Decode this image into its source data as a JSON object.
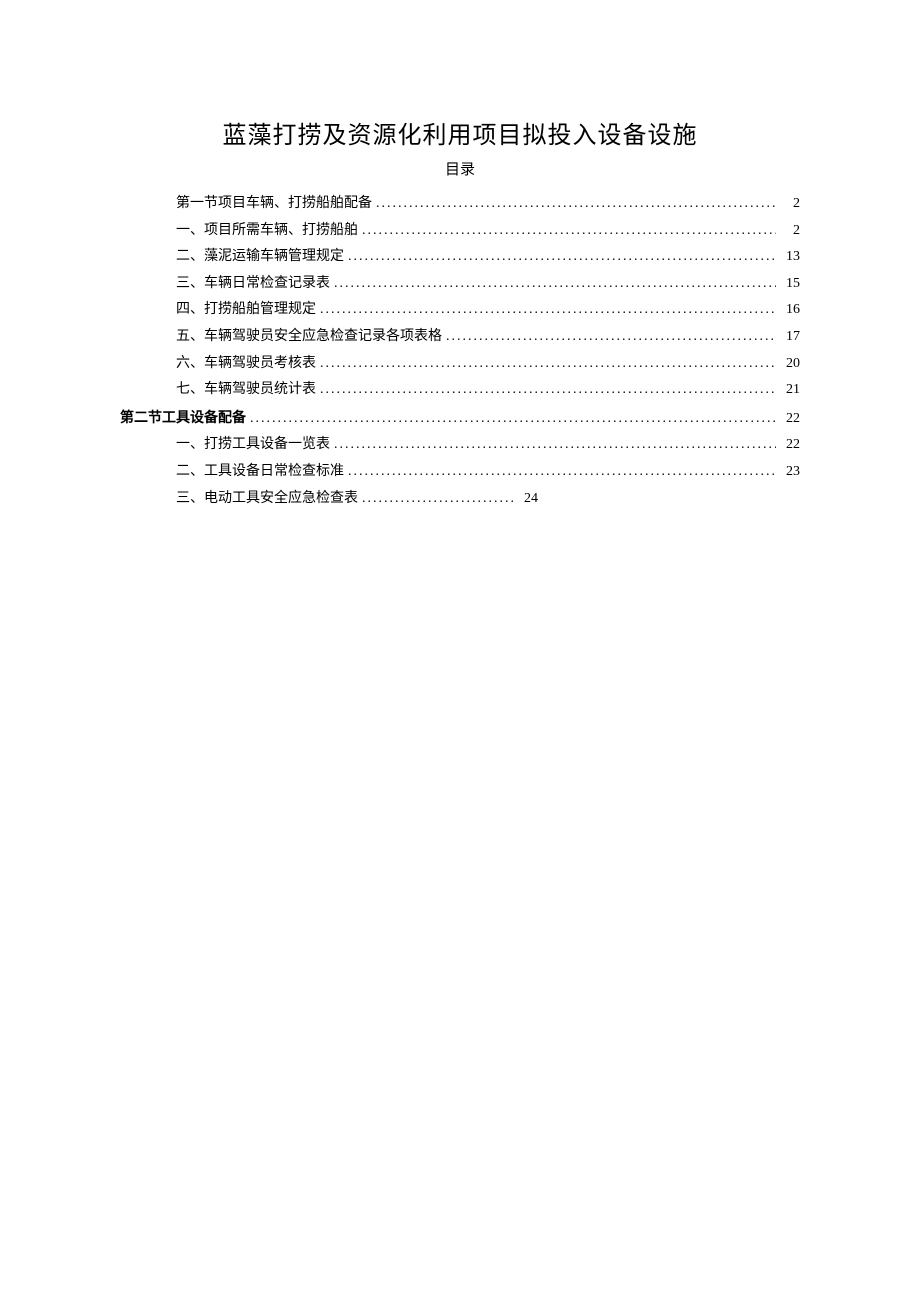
{
  "title": "蓝藻打捞及资源化利用项目拟投入设备设施",
  "subtitle": "目录",
  "toc": [
    {
      "label": "第一节项目车辆、打捞船舶配备",
      "page": "2",
      "indent": true,
      "bold": false,
      "short": false
    },
    {
      "label": "一、项目所需车辆、打捞船舶",
      "page": "2",
      "indent": true,
      "bold": false,
      "short": false
    },
    {
      "label": "二、藻泥运输车辆管理规定",
      "page": "13",
      "indent": true,
      "bold": false,
      "short": false
    },
    {
      "label": "三、车辆日常检查记录表",
      "page": "15",
      "indent": true,
      "bold": false,
      "short": false
    },
    {
      "label": "四、打捞船舶管理规定",
      "page": "16",
      "indent": true,
      "bold": false,
      "short": false
    },
    {
      "label": "五、车辆驾驶员安全应急检查记录各项表格",
      "page": "17",
      "indent": true,
      "bold": false,
      "short": false
    },
    {
      "label": "六、车辆驾驶员考核表",
      "page": "20",
      "indent": true,
      "bold": false,
      "short": false
    },
    {
      "label": "七、车辆驾驶员统计表",
      "page": "21",
      "indent": true,
      "bold": false,
      "short": false
    },
    {
      "label": "第二节工具设备配备",
      "page": "22",
      "indent": false,
      "bold": true,
      "short": false
    },
    {
      "label": "一、打捞工具设备一览表",
      "page": "22",
      "indent": true,
      "bold": false,
      "short": false
    },
    {
      "label": "二、工具设备日常检查标准",
      "page": "23",
      "indent": true,
      "bold": false,
      "short": false
    },
    {
      "label": "三、电动工具安全应急检查表",
      "page": "24",
      "indent": true,
      "bold": false,
      "short": true
    }
  ]
}
